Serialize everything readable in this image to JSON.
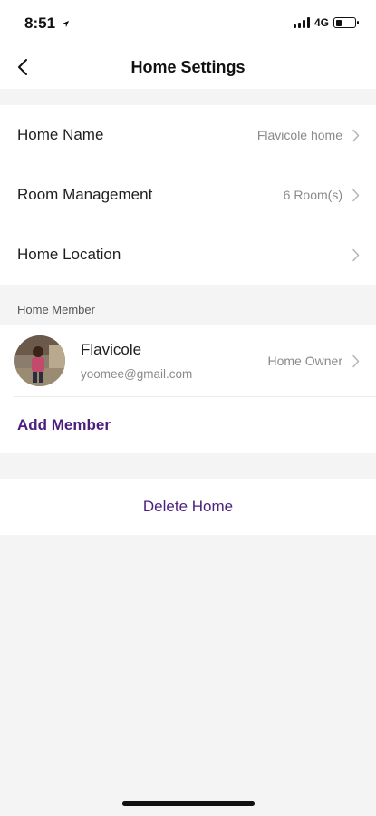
{
  "status_bar": {
    "time": "8:51",
    "location_icon": "location-arrow-icon",
    "network": "4G",
    "signal_icon": "cellular-signal-icon",
    "battery_icon": "battery-icon"
  },
  "nav": {
    "back_icon": "chevron-left-icon",
    "title": "Home Settings"
  },
  "settings": {
    "home_name": {
      "label": "Home Name",
      "value": "Flavicole home"
    },
    "room_management": {
      "label": "Room Management",
      "value": "6 Room(s)"
    },
    "home_location": {
      "label": "Home Location",
      "value": ""
    }
  },
  "members_section": {
    "label": "Home Member",
    "members": [
      {
        "name": "Flavicole",
        "email": "yoomee@gmail.com",
        "role": "Home Owner"
      }
    ],
    "add_label": "Add Member"
  },
  "actions": {
    "delete_label": "Delete Home"
  },
  "colors": {
    "accent": "#4b1f7d",
    "background": "#f4f4f4",
    "card": "#ffffff",
    "secondary_text": "#8a8a8a"
  }
}
